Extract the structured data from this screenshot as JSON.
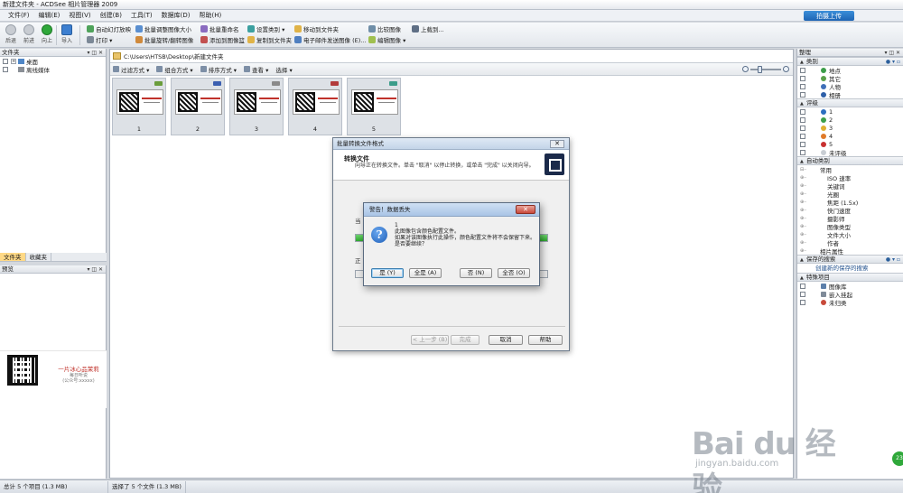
{
  "window": {
    "title": "新建文件夹 - ACDSee 相片管理器 2009"
  },
  "menu": [
    "文件(F)",
    "编辑(E)",
    "视图(V)",
    "创建(B)",
    "工具(T)",
    "数据库(D)",
    "帮助(H)"
  ],
  "upload_button": "拍摄上传",
  "toolbar": {
    "nav": [
      {
        "label": "后退"
      },
      {
        "label": "前进"
      },
      {
        "label": "向上"
      },
      {
        "label": "导入"
      }
    ],
    "col1": [
      "自动幻灯放映",
      "打印 ▾"
    ],
    "col2": [
      "批量调整图像大小",
      "批量旋转/翻转图像"
    ],
    "col3": [
      "批量重命名",
      "添加到图像篮"
    ],
    "col4": [
      "设置类别 ▾",
      "复制到文件夹"
    ],
    "col5": [
      "移动到文件夹",
      "电子邮件发送图像 (E)..."
    ],
    "col6": [
      "比较图像",
      "编辑图像 ▾"
    ],
    "col7": [
      "上载到..."
    ]
  },
  "folders_panel": {
    "title": "文件夹",
    "items": [
      "桌面",
      "离线媒体"
    ],
    "tabs": [
      "文件夹",
      "收藏夹"
    ]
  },
  "preview_panel": {
    "title": "预览",
    "text": "一片冰心品茉莉",
    "sub1": "每日听说",
    "sub2": "(公众号:xxxxx)"
  },
  "path": "C:\\Users\\HTSB\\Desktop\\新建文件夹",
  "filterbar": [
    "过滤方式 ▾",
    "组合方式 ▾",
    "排序方式 ▾",
    "查看 ▾",
    "选择 ▾"
  ],
  "thumbnails": [
    "1",
    "2",
    "3",
    "4",
    "5"
  ],
  "organize_panel": {
    "title": "整理",
    "categories_title": "类别",
    "categories": [
      "地点",
      "其它",
      "人物",
      "相册"
    ],
    "rating_title": "评级",
    "ratings": [
      "1",
      "2",
      "3",
      "4",
      "5",
      "未评级"
    ],
    "auto_title": "自动类别",
    "auto_root": "常用",
    "auto_items": [
      "ISO 速率",
      "关键词",
      "光圈",
      "焦距 (1.5x)",
      "快门速度",
      "摄影师",
      "图像类型",
      "文件大小",
      "作者"
    ],
    "auto_last": "相片属性",
    "saved_title": "保存的搜索",
    "saved_link": "创建新的保存的搜索",
    "special_title": "特殊项目",
    "special_items": [
      "图像库",
      "嵌入挂起",
      "未归类"
    ]
  },
  "convert_dialog": {
    "title": "批量转换文件格式",
    "heading": "转换文件",
    "desc": "向导正在转换文件。单击 \"取消\" 以停止转换，或单击 \"完成\" 以关闭向导。",
    "label1": "当",
    "label2": "正",
    "buttons": [
      "< 上一步 (B)",
      "完成",
      "取消",
      "帮助"
    ]
  },
  "alert": {
    "title": "警告！数据丢失",
    "line1": "1",
    "line2": "此图像包含颜色配置文件。",
    "line3": "如果对该图像执行此操作，颜色配置文件将不会保留下来。",
    "line4": "是否要继续？",
    "buttons": [
      "是 (Y)",
      "全是 (A)",
      "否 (N)",
      "全否 (O)"
    ]
  },
  "status": [
    "总计 5 个项目 (1.3 MB)",
    "选择了 5 个文件 (1.3 MB)"
  ],
  "watermark": {
    "text": "Bai du 经验",
    "sub": "jingyan.baidu.com"
  },
  "badge": "23"
}
